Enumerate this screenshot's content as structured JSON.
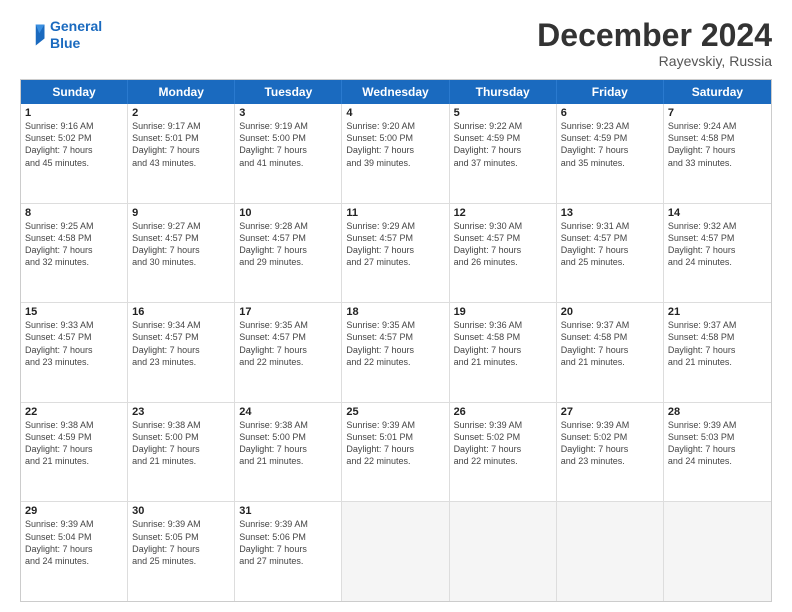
{
  "header": {
    "logo_line1": "General",
    "logo_line2": "Blue",
    "month": "December 2024",
    "location": "Rayevskiy, Russia"
  },
  "weekdays": [
    "Sunday",
    "Monday",
    "Tuesday",
    "Wednesday",
    "Thursday",
    "Friday",
    "Saturday"
  ],
  "rows": [
    [
      {
        "day": "1",
        "lines": [
          "Sunrise: 9:16 AM",
          "Sunset: 5:02 PM",
          "Daylight: 7 hours",
          "and 45 minutes."
        ]
      },
      {
        "day": "2",
        "lines": [
          "Sunrise: 9:17 AM",
          "Sunset: 5:01 PM",
          "Daylight: 7 hours",
          "and 43 minutes."
        ]
      },
      {
        "day": "3",
        "lines": [
          "Sunrise: 9:19 AM",
          "Sunset: 5:00 PM",
          "Daylight: 7 hours",
          "and 41 minutes."
        ]
      },
      {
        "day": "4",
        "lines": [
          "Sunrise: 9:20 AM",
          "Sunset: 5:00 PM",
          "Daylight: 7 hours",
          "and 39 minutes."
        ]
      },
      {
        "day": "5",
        "lines": [
          "Sunrise: 9:22 AM",
          "Sunset: 4:59 PM",
          "Daylight: 7 hours",
          "and 37 minutes."
        ]
      },
      {
        "day": "6",
        "lines": [
          "Sunrise: 9:23 AM",
          "Sunset: 4:59 PM",
          "Daylight: 7 hours",
          "and 35 minutes."
        ]
      },
      {
        "day": "7",
        "lines": [
          "Sunrise: 9:24 AM",
          "Sunset: 4:58 PM",
          "Daylight: 7 hours",
          "and 33 minutes."
        ]
      }
    ],
    [
      {
        "day": "8",
        "lines": [
          "Sunrise: 9:25 AM",
          "Sunset: 4:58 PM",
          "Daylight: 7 hours",
          "and 32 minutes."
        ]
      },
      {
        "day": "9",
        "lines": [
          "Sunrise: 9:27 AM",
          "Sunset: 4:57 PM",
          "Daylight: 7 hours",
          "and 30 minutes."
        ]
      },
      {
        "day": "10",
        "lines": [
          "Sunrise: 9:28 AM",
          "Sunset: 4:57 PM",
          "Daylight: 7 hours",
          "and 29 minutes."
        ]
      },
      {
        "day": "11",
        "lines": [
          "Sunrise: 9:29 AM",
          "Sunset: 4:57 PM",
          "Daylight: 7 hours",
          "and 27 minutes."
        ]
      },
      {
        "day": "12",
        "lines": [
          "Sunrise: 9:30 AM",
          "Sunset: 4:57 PM",
          "Daylight: 7 hours",
          "and 26 minutes."
        ]
      },
      {
        "day": "13",
        "lines": [
          "Sunrise: 9:31 AM",
          "Sunset: 4:57 PM",
          "Daylight: 7 hours",
          "and 25 minutes."
        ]
      },
      {
        "day": "14",
        "lines": [
          "Sunrise: 9:32 AM",
          "Sunset: 4:57 PM",
          "Daylight: 7 hours",
          "and 24 minutes."
        ]
      }
    ],
    [
      {
        "day": "15",
        "lines": [
          "Sunrise: 9:33 AM",
          "Sunset: 4:57 PM",
          "Daylight: 7 hours",
          "and 23 minutes."
        ]
      },
      {
        "day": "16",
        "lines": [
          "Sunrise: 9:34 AM",
          "Sunset: 4:57 PM",
          "Daylight: 7 hours",
          "and 23 minutes."
        ]
      },
      {
        "day": "17",
        "lines": [
          "Sunrise: 9:35 AM",
          "Sunset: 4:57 PM",
          "Daylight: 7 hours",
          "and 22 minutes."
        ]
      },
      {
        "day": "18",
        "lines": [
          "Sunrise: 9:35 AM",
          "Sunset: 4:57 PM",
          "Daylight: 7 hours",
          "and 22 minutes."
        ]
      },
      {
        "day": "19",
        "lines": [
          "Sunrise: 9:36 AM",
          "Sunset: 4:58 PM",
          "Daylight: 7 hours",
          "and 21 minutes."
        ]
      },
      {
        "day": "20",
        "lines": [
          "Sunrise: 9:37 AM",
          "Sunset: 4:58 PM",
          "Daylight: 7 hours",
          "and 21 minutes."
        ]
      },
      {
        "day": "21",
        "lines": [
          "Sunrise: 9:37 AM",
          "Sunset: 4:58 PM",
          "Daylight: 7 hours",
          "and 21 minutes."
        ]
      }
    ],
    [
      {
        "day": "22",
        "lines": [
          "Sunrise: 9:38 AM",
          "Sunset: 4:59 PM",
          "Daylight: 7 hours",
          "and 21 minutes."
        ]
      },
      {
        "day": "23",
        "lines": [
          "Sunrise: 9:38 AM",
          "Sunset: 5:00 PM",
          "Daylight: 7 hours",
          "and 21 minutes."
        ]
      },
      {
        "day": "24",
        "lines": [
          "Sunrise: 9:38 AM",
          "Sunset: 5:00 PM",
          "Daylight: 7 hours",
          "and 21 minutes."
        ]
      },
      {
        "day": "25",
        "lines": [
          "Sunrise: 9:39 AM",
          "Sunset: 5:01 PM",
          "Daylight: 7 hours",
          "and 22 minutes."
        ]
      },
      {
        "day": "26",
        "lines": [
          "Sunrise: 9:39 AM",
          "Sunset: 5:02 PM",
          "Daylight: 7 hours",
          "and 22 minutes."
        ]
      },
      {
        "day": "27",
        "lines": [
          "Sunrise: 9:39 AM",
          "Sunset: 5:02 PM",
          "Daylight: 7 hours",
          "and 23 minutes."
        ]
      },
      {
        "day": "28",
        "lines": [
          "Sunrise: 9:39 AM",
          "Sunset: 5:03 PM",
          "Daylight: 7 hours",
          "and 24 minutes."
        ]
      }
    ],
    [
      {
        "day": "29",
        "lines": [
          "Sunrise: 9:39 AM",
          "Sunset: 5:04 PM",
          "Daylight: 7 hours",
          "and 24 minutes."
        ]
      },
      {
        "day": "30",
        "lines": [
          "Sunrise: 9:39 AM",
          "Sunset: 5:05 PM",
          "Daylight: 7 hours",
          "and 25 minutes."
        ]
      },
      {
        "day": "31",
        "lines": [
          "Sunrise: 9:39 AM",
          "Sunset: 5:06 PM",
          "Daylight: 7 hours",
          "and 27 minutes."
        ]
      },
      {
        "day": "",
        "lines": []
      },
      {
        "day": "",
        "lines": []
      },
      {
        "day": "",
        "lines": []
      },
      {
        "day": "",
        "lines": []
      }
    ]
  ]
}
